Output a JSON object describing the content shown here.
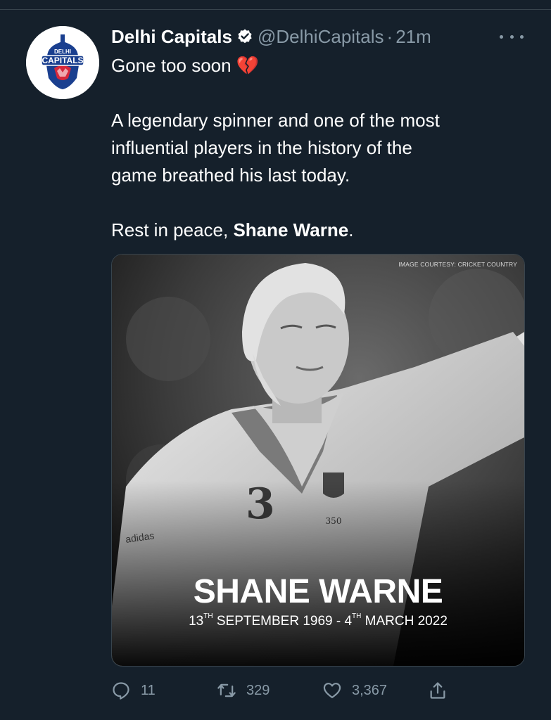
{
  "tweet": {
    "display_name": "Delhi Capitals",
    "handle": "@DelhiCapitals",
    "separator": "·",
    "time": "21m",
    "lines": {
      "line1": "Gone too soon 💔",
      "line2": "A legendary spinner and one of the most",
      "line3": "influential players in the history of the",
      "line4": "game breathed his last today.",
      "line5_prefix": "Rest in peace, ",
      "line5_bold": "Shane Warne",
      "line5_suffix": "."
    },
    "avatar_logo": {
      "top": "DELHI",
      "main": "CAPITALS"
    }
  },
  "media": {
    "courtesy": "IMAGE COURTESY: CRICKET COUNTRY",
    "name": "SHANE WARNE",
    "dates": {
      "start_day": "13",
      "start_sup": "TH",
      "start_rest": " SEPTEMBER 1969 - 4",
      "end_sup": "TH",
      "end_rest": " MARCH 2022"
    },
    "shirt_number": "3",
    "badge_number": "350",
    "brand_mark": "adidas"
  },
  "actions": {
    "reply_count": "11",
    "retweet_count": "329",
    "like_count": "3,367"
  },
  "colors": {
    "background": "#15202b",
    "secondary_text": "#8899a6",
    "verified": "#ffffff",
    "broken_heart": "#e0245e"
  }
}
